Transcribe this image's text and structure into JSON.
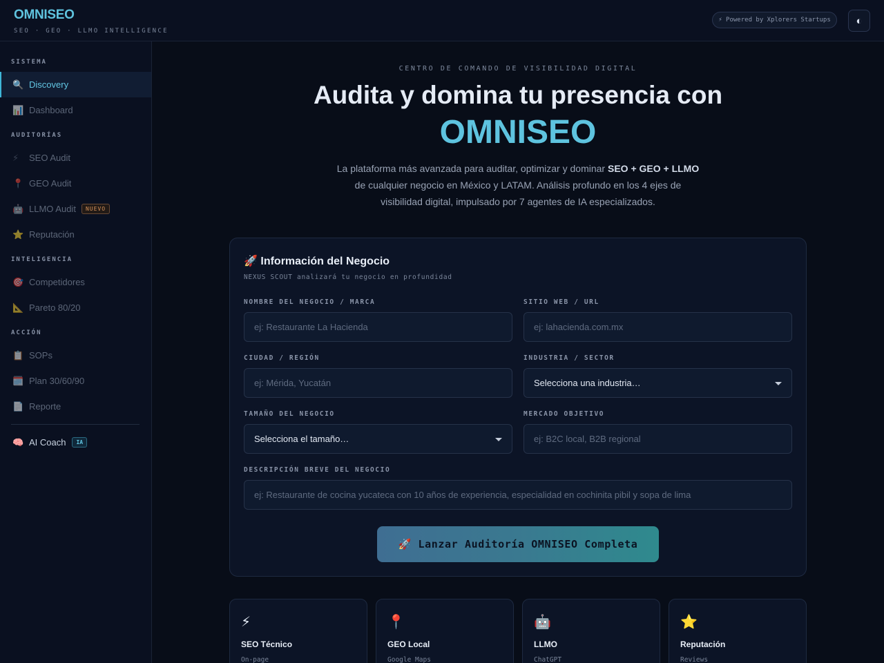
{
  "header": {
    "brand": "OMNISEO",
    "tagline": "SEO · GEO · LLMO INTELLIGENCE",
    "powered": "⚡ Powered by Xplorers Startups",
    "theme_icon": "◐"
  },
  "sidebar": {
    "sections": [
      "SISTEMA",
      "AUDITORÍAS",
      "INTELIGENCIA",
      "ACCIÓN"
    ],
    "items": [
      {
        "icon": "🔍",
        "label": "Discovery"
      },
      {
        "icon": "📊",
        "label": "Dashboard"
      },
      {
        "icon": "⚡",
        "label": "SEO Audit"
      },
      {
        "icon": "📍",
        "label": "GEO Audit"
      },
      {
        "icon": "🤖",
        "label": "LLMO Audit",
        "badge": "NUEVO"
      },
      {
        "icon": "⭐",
        "label": "Reputación"
      },
      {
        "icon": "🎯",
        "label": "Competidores"
      },
      {
        "icon": "📐",
        "label": "Pareto 80/20"
      },
      {
        "icon": "📋",
        "label": "SOPs"
      },
      {
        "icon": "🗓️",
        "label": "Plan 30/60/90"
      },
      {
        "icon": "📄",
        "label": "Reporte"
      },
      {
        "icon": "🧠",
        "label": "AI Coach",
        "badge": "IA"
      }
    ]
  },
  "hero": {
    "eyebrow": "CENTRO DE COMANDO DE VISIBILIDAD DIGITAL",
    "title_line1": "Audita y domina tu presencia con",
    "title_line2": "OMNISEO",
    "lead_1": "La plataforma más avanzada para auditar, optimizar y dominar ",
    "lead_bold": "SEO + GEO + LLMO",
    "lead_2": " de cualquier negocio en México y LATAM. Análisis profundo en los 4 ejes de visibilidad digital, impulsado por 7 agentes de IA especializados."
  },
  "form": {
    "title": "🚀 Información del Negocio",
    "subtitle": "NEXUS SCOUT analizará tu negocio en profundidad",
    "fields": {
      "name": {
        "label": "NOMBRE DEL NEGOCIO / MARCA",
        "placeholder": "ej: Restaurante La Hacienda"
      },
      "website": {
        "label": "SITIO WEB / URL",
        "placeholder": "ej: lahacienda.com.mx"
      },
      "city": {
        "label": "CIUDAD / REGIÓN",
        "placeholder": "ej: Mérida, Yucatán"
      },
      "industry": {
        "label": "INDUSTRIA / SECTOR",
        "value": "Selecciona una industria…"
      },
      "size": {
        "label": "TAMAÑO DEL NEGOCIO",
        "value": "Selecciona el tamaño…"
      },
      "market": {
        "label": "MERCADO OBJETIVO",
        "placeholder": "ej: B2C local, B2B regional"
      },
      "description": {
        "label": "DESCRIPCIÓN BREVE DEL NEGOCIO",
        "placeholder": "ej: Restaurante de cocina yucateca con 10 años de experiencia, especialidad en cochinita pibil y sopa de lima"
      }
    },
    "submit": "🚀 Lanzar Auditoría OMNISEO Completa"
  },
  "pillars": [
    {
      "icon": "⚡",
      "title": "SEO Técnico",
      "sub": "On-page"
    },
    {
      "icon": "📍",
      "title": "GEO Local",
      "sub": "Google Maps"
    },
    {
      "icon": "🤖",
      "title": "LLMO",
      "sub": "ChatGPT"
    },
    {
      "icon": "⭐",
      "title": "Reputación",
      "sub": "Reviews"
    }
  ]
}
